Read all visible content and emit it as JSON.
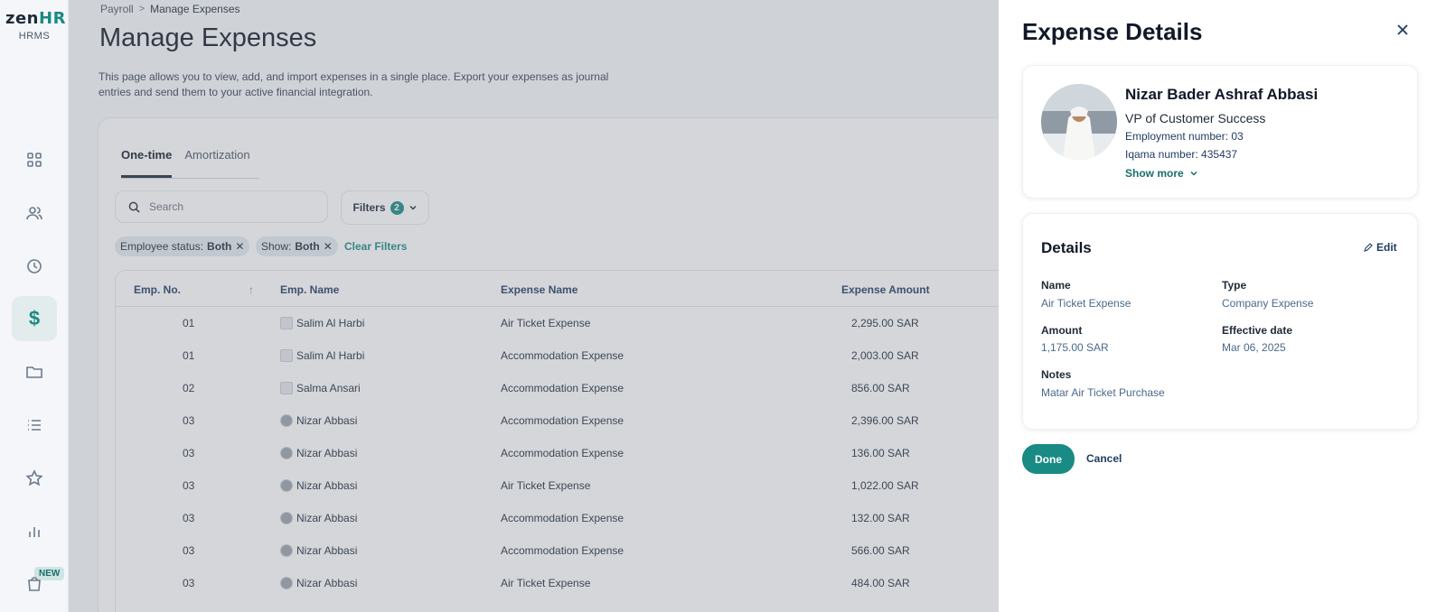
{
  "app": {
    "brand_main": "zen",
    "brand_accent": "HR",
    "brand_sub": "HRMS",
    "accent_color": "#1a8a84"
  },
  "sidebar": {
    "items": [
      {
        "icon": "dashboard-grid-icon"
      },
      {
        "icon": "people-icon"
      },
      {
        "icon": "clock-icon"
      },
      {
        "icon": "dollar-icon",
        "active": true,
        "glyph": "$"
      },
      {
        "icon": "folder-icon"
      },
      {
        "icon": "list-icon"
      },
      {
        "icon": "star-icon"
      },
      {
        "icon": "bar-chart-icon"
      },
      {
        "icon": "bag-icon"
      }
    ],
    "new_badge": "NEW"
  },
  "breadcrumb": {
    "parent": "Payroll",
    "separator": ">",
    "current": "Manage Expenses"
  },
  "page": {
    "title": "Manage Expenses",
    "description": "This page allows you to view, add, and import expenses in a single place. Export your expenses as journal entries and send them to your active financial integration."
  },
  "tabs": [
    {
      "label": "One-time",
      "active": true
    },
    {
      "label": "Amortization",
      "active": false
    }
  ],
  "search": {
    "placeholder": "Search",
    "value": ""
  },
  "filters": {
    "label": "Filters",
    "count": "2"
  },
  "chips": [
    {
      "key": "Employee status:",
      "value": "Both"
    },
    {
      "key": "Show:",
      "value": "Both"
    }
  ],
  "clear_filters": "Clear Filters",
  "table": {
    "headers": [
      "Emp. No.",
      "Emp. Name",
      "Expense Name",
      "Expense Amount"
    ],
    "sort_indicator": "↑",
    "rows": [
      {
        "no": "01",
        "name": "Salim Al Harbi",
        "expense": "Air Ticket Expense",
        "amount": "2,295.00 SAR"
      },
      {
        "no": "01",
        "name": "Salim Al Harbi",
        "expense": "Accommodation Expense",
        "amount": "2,003.00 SAR"
      },
      {
        "no": "02",
        "name": "Salma Ansari",
        "expense": "Accommodation Expense",
        "amount": "856.00 SAR"
      },
      {
        "no": "03",
        "name": "Nizar Abbasi",
        "expense": "Accommodation Expense",
        "amount": "2,396.00 SAR"
      },
      {
        "no": "03",
        "name": "Nizar Abbasi",
        "expense": "Accommodation Expense",
        "amount": "136.00 SAR"
      },
      {
        "no": "03",
        "name": "Nizar Abbasi",
        "expense": "Air Ticket Expense",
        "amount": "1,022.00 SAR"
      },
      {
        "no": "03",
        "name": "Nizar Abbasi",
        "expense": "Accommodation Expense",
        "amount": "132.00 SAR"
      },
      {
        "no": "03",
        "name": "Nizar Abbasi",
        "expense": "Accommodation Expense",
        "amount": "566.00 SAR"
      },
      {
        "no": "03",
        "name": "Nizar Abbasi",
        "expense": "Air Ticket Expense",
        "amount": "484.00 SAR"
      }
    ]
  },
  "drawer": {
    "title": "Expense Details",
    "employee": {
      "name": "Nizar Bader Ashraf Abbasi",
      "role": "VP of Customer Success",
      "employment_number": "Employment number: 03",
      "iqama_number": "Iqama number: 435437",
      "show_more": "Show more"
    },
    "details": {
      "heading": "Details",
      "edit_label": "Edit",
      "name_label": "Name",
      "name_value": "Air Ticket Expense",
      "type_label": "Type",
      "type_value": "Company Expense",
      "amount_label": "Amount",
      "amount_value": "1,175.00 SAR",
      "date_label": "Effective date",
      "date_value": "Mar 06, 2025",
      "notes_label": "Notes",
      "notes_value": "Matar Air Ticket Purchase"
    },
    "done_label": "Done",
    "cancel_label": "Cancel"
  }
}
